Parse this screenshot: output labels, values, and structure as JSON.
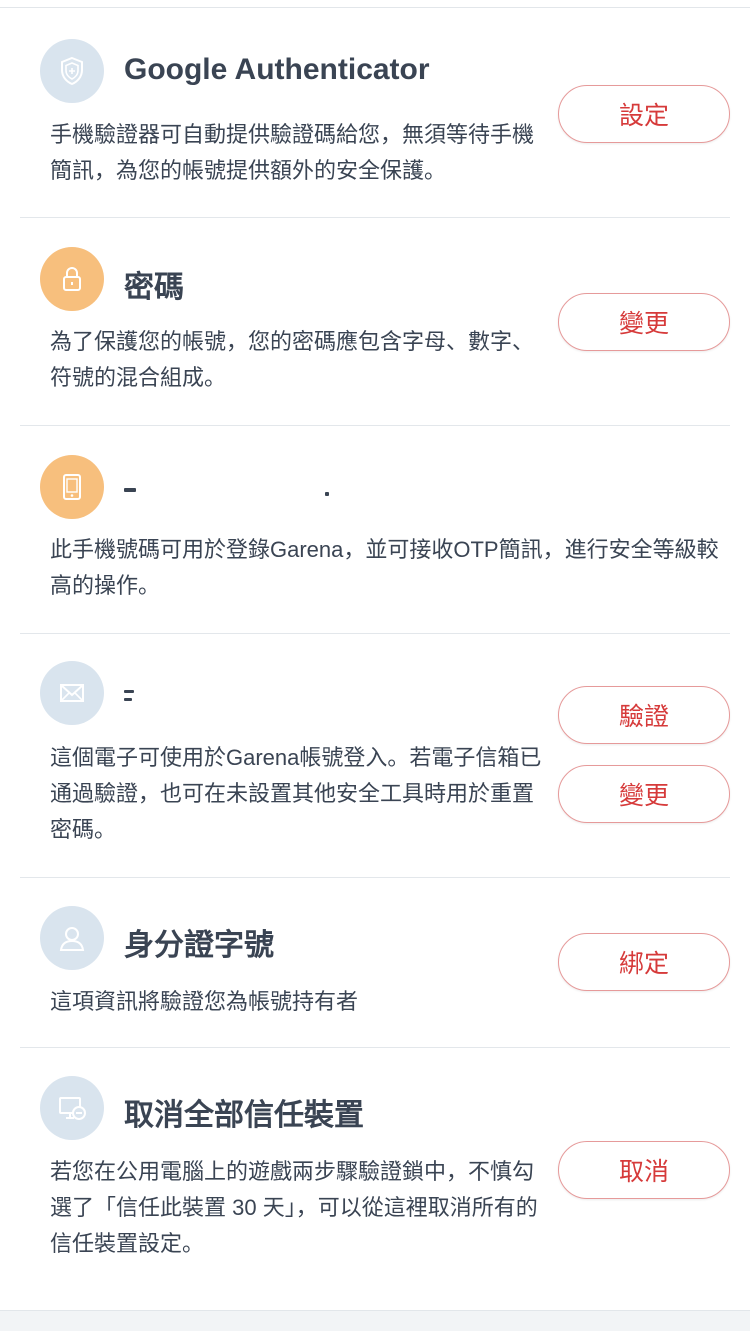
{
  "sections": [
    {
      "title": "Google Authenticator",
      "icon": "shield-icon",
      "desc": "手機驗證器可自動提供驗證碼給您，無須等待手機簡訊，為您的帳號提供額外的安全保護。",
      "button": "設定"
    },
    {
      "title": "密碼",
      "icon": "lock-icon",
      "desc": "為了保護您的帳號，您的密碼應包含字母、數字、符號的混合組成。",
      "button": "變更"
    },
    {
      "title": "",
      "icon": "phone-icon",
      "desc": "此手機號碼可用於登錄Garena，並可接收OTP簡訊，進行安全等級較高的操作。"
    },
    {
      "title": "",
      "icon": "envelope-icon",
      "desc": "這個電子可使用於Garena帳號登入。若電子信箱已通過驗證，也可在未設置其他安全工具時用於重置密碼。",
      "buttons": [
        "驗證",
        "變更"
      ]
    },
    {
      "title": "身分證字號",
      "icon": "user-icon",
      "desc": "這項資訊將驗證您為帳號持有者",
      "button": "綁定"
    },
    {
      "title": "取消全部信任裝置",
      "icon": "device-cancel-icon",
      "desc": "若您在公用電腦上的遊戲兩步驟驗證鎖中，不慎勾選了「信任此裝置 30 天」，可以從這裡取消所有的信任裝置設定。",
      "button": "取消"
    }
  ],
  "colors": {
    "accent": "#d63a3a",
    "button_border": "#e69a9a",
    "icon_blue": "#d9e4ee",
    "icon_orange": "#f7bf7d",
    "text": "#3a4453"
  }
}
